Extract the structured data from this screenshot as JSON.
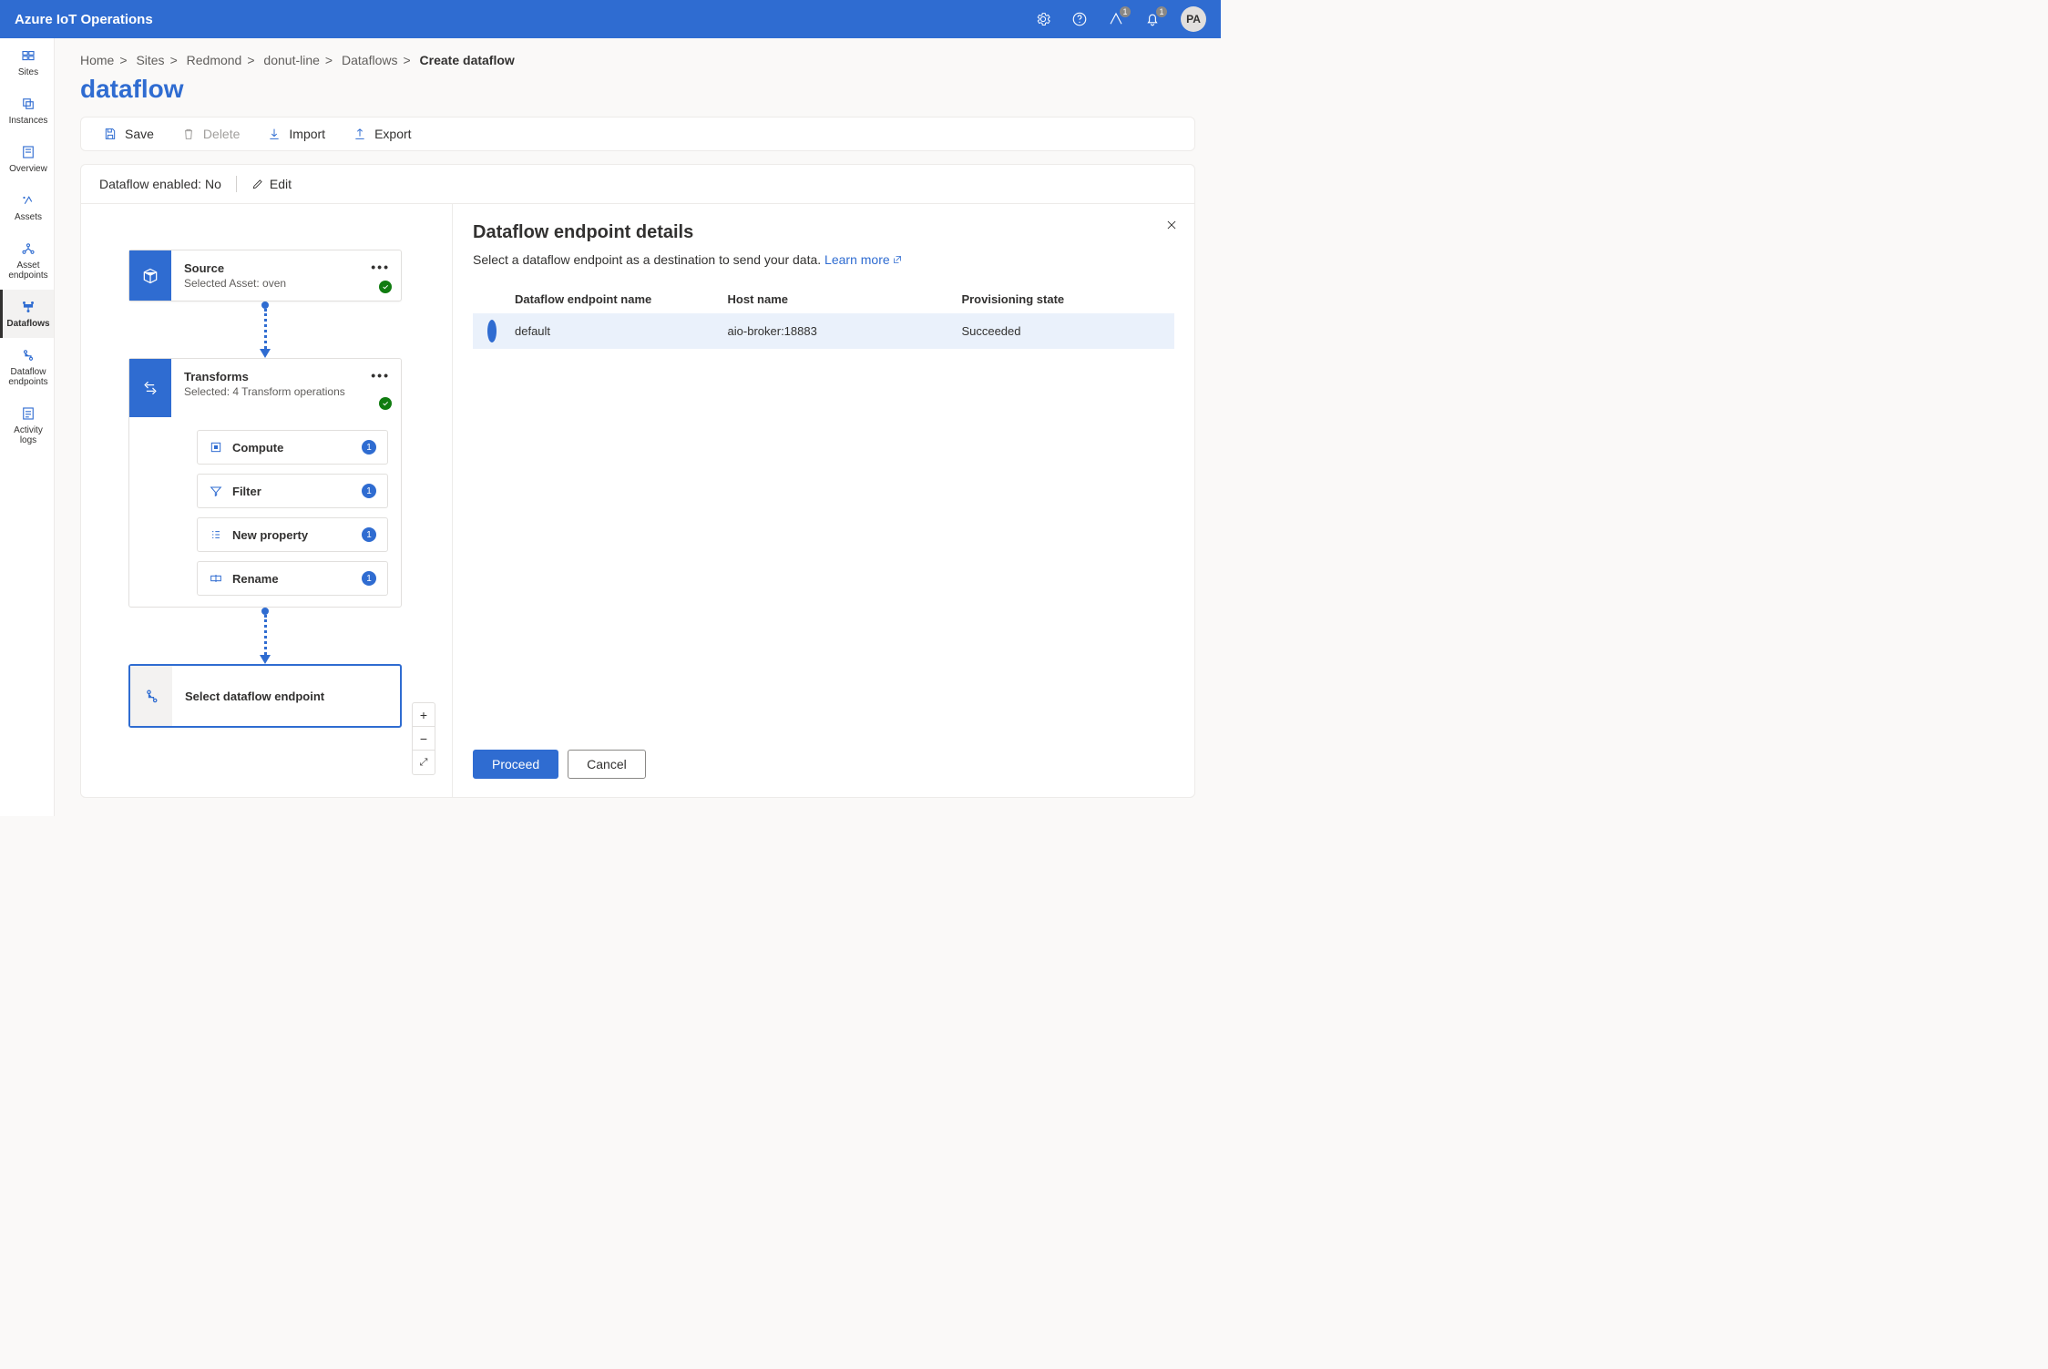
{
  "app_title": "Azure IoT Operations",
  "avatar_initials": "PA",
  "notification_badge": "1",
  "alert_badge": "1",
  "breadcrumb": {
    "items": [
      "Home",
      "Sites",
      "Redmond",
      "donut-line",
      "Dataflows"
    ],
    "current": "Create dataflow"
  },
  "page_title": "dataflow",
  "sidebar": {
    "items": [
      {
        "label": "Sites"
      },
      {
        "label": "Instances"
      },
      {
        "label": "Overview"
      },
      {
        "label": "Assets"
      },
      {
        "label": "Asset endpoints"
      },
      {
        "label": "Dataflows"
      },
      {
        "label": "Dataflow endpoints"
      },
      {
        "label": "Activity logs"
      }
    ]
  },
  "toolbar": {
    "save": "Save",
    "delete": "Delete",
    "import": "Import",
    "export": "Export"
  },
  "status": {
    "enabled_label": "Dataflow enabled: No",
    "edit": "Edit"
  },
  "nodes": {
    "source": {
      "title": "Source",
      "subtitle": "Selected Asset: oven"
    },
    "transforms": {
      "title": "Transforms",
      "subtitle": "Selected: 4 Transform operations",
      "ops": [
        {
          "label": "Compute",
          "count": "1"
        },
        {
          "label": "Filter",
          "count": "1"
        },
        {
          "label": "New property",
          "count": "1"
        },
        {
          "label": "Rename",
          "count": "1"
        }
      ]
    },
    "endpoint": {
      "title": "Select dataflow endpoint"
    }
  },
  "panel": {
    "title": "Dataflow endpoint details",
    "desc": "Select a dataflow endpoint as a destination to send your data.",
    "learn_more": "Learn more",
    "columns": {
      "name": "Dataflow endpoint name",
      "host": "Host name",
      "state": "Provisioning state"
    },
    "rows": [
      {
        "name": "default",
        "host": "aio-broker:18883",
        "state": "Succeeded"
      }
    ],
    "proceed": "Proceed",
    "cancel": "Cancel"
  }
}
